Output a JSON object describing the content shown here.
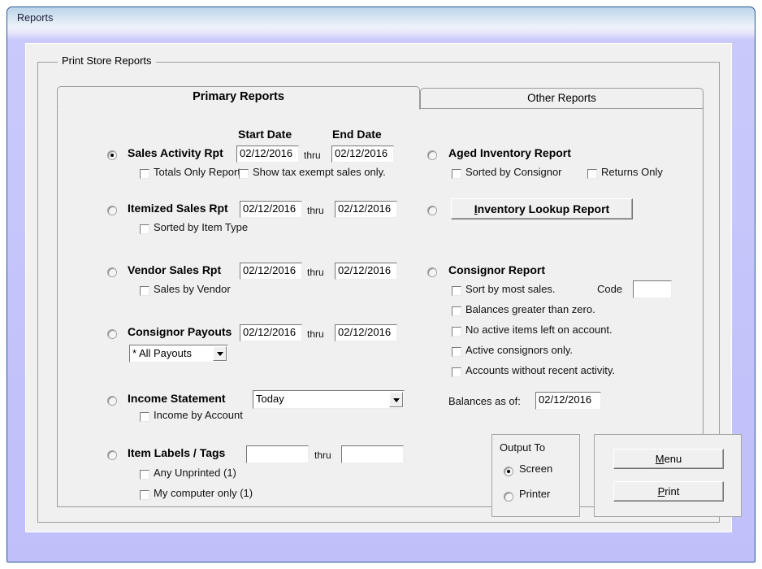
{
  "window": {
    "title": "Reports"
  },
  "group": {
    "legend": "Print Store Reports"
  },
  "tabs": [
    {
      "label": "Primary Reports",
      "active": true
    },
    {
      "label": "Other Reports",
      "active": false
    }
  ],
  "columns": {
    "start_date": "Start Date",
    "end_date": "End Date"
  },
  "thru_label": "thru",
  "primary_reports": [
    {
      "name": "Sales Activity Rpt",
      "selected": true,
      "start_date": "02/12/2016",
      "end_date": "02/12/2016",
      "options": [
        {
          "label": "Totals Only Report",
          "checked": false
        },
        {
          "label": "Show tax exempt sales only.",
          "checked": false
        }
      ]
    },
    {
      "name": "Itemized Sales Rpt",
      "selected": false,
      "start_date": "02/12/2016",
      "end_date": "02/12/2016",
      "options": [
        {
          "label": "Sorted by Item Type",
          "checked": false
        }
      ]
    },
    {
      "name": "Vendor Sales Rpt",
      "selected": false,
      "start_date": "02/12/2016",
      "end_date": "02/12/2016",
      "options": [
        {
          "label": "Sales by Vendor",
          "checked": false
        }
      ]
    },
    {
      "name": "Consignor Payouts",
      "selected": false,
      "start_date": "02/12/2016",
      "end_date": "02/12/2016",
      "payout_filter": "* All Payouts"
    },
    {
      "name": "Income Statement",
      "selected": false,
      "period": "Today",
      "options": [
        {
          "label": "Income by Account",
          "checked": false
        }
      ]
    },
    {
      "name": "Item Labels / Tags",
      "selected": false,
      "start_value": "",
      "end_value": "",
      "options": [
        {
          "label": "Any Unprinted  (1)",
          "checked": false
        },
        {
          "label": "My computer only  (1)",
          "checked": false
        }
      ]
    }
  ],
  "other_reports": {
    "aged_inventory": {
      "name": "Aged Inventory Report",
      "selected": false,
      "options": [
        {
          "label": "Sorted by Consignor",
          "checked": false
        },
        {
          "label": "Returns Only",
          "checked": false
        }
      ]
    },
    "inventory_lookup": {
      "selected": false,
      "button_accel": "I",
      "button_rest": "nventory Lookup Report"
    },
    "consignor_report": {
      "name": "Consignor Report",
      "selected": false,
      "options": [
        {
          "label": "Sort by most sales.",
          "checked": false
        },
        {
          "label": "Balances greater than zero.",
          "checked": false
        },
        {
          "label": "No active items left on account.",
          "checked": false
        },
        {
          "label": "Active consignors only.",
          "checked": false
        },
        {
          "label": "Accounts without recent activity.",
          "checked": false
        }
      ],
      "code_label": "Code",
      "code_value": "",
      "balances_label": "Balances as of:",
      "balances_date": "02/12/2016"
    }
  },
  "output_to": {
    "legend": "Output To",
    "options": [
      {
        "label": "Screen",
        "selected": true
      },
      {
        "label": "Printer",
        "selected": false
      }
    ]
  },
  "actions": {
    "menu": {
      "accel": "M",
      "rest": "enu"
    },
    "print": {
      "accel": "P",
      "rest": "rint"
    }
  },
  "colors": {
    "title_bar_start": "#bcd4ea",
    "title_bar_end": "#bfbffa",
    "window_border": "#2b5797",
    "form_face": "#f0f0f0",
    "field_bg": "#ffffff",
    "text": "#000000"
  }
}
